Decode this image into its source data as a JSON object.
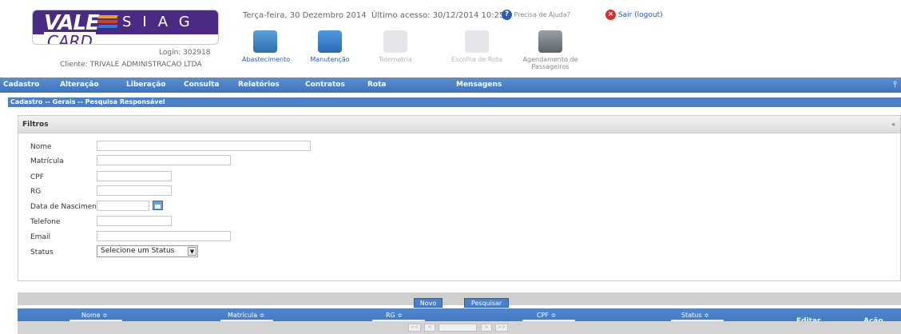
{
  "header": {
    "logo_vale": "VALE",
    "logo_card": "CARD",
    "logo_siag": "SIAG",
    "login": "Login: 302918",
    "cliente": "Cliente: TRIVALE ADMINISTRACAO LTDA",
    "date": "Terça-feira, 30 Dezembro 2014",
    "last_access": "Último acesso: 30/12/2014 10:25",
    "help": "Precisa de Ajuda?",
    "logout": "Sair (logout)"
  },
  "toolbar": [
    {
      "label": "Abastecimento",
      "icon": "fuel-icon"
    },
    {
      "label": "Manutenção",
      "icon": "wrench-icon"
    },
    {
      "label": "Telemetria",
      "icon": "signal-icon"
    },
    {
      "label": "Escolha de Rota",
      "icon": "map-icon"
    },
    {
      "label": "Agendamento de Passageiros",
      "icon": "bus-icon"
    }
  ],
  "nav": [
    "Cadastro",
    "Alteração",
    "Liberação",
    "Consulta",
    "Relatórios",
    "Contratos",
    "Rota",
    "Mensagens"
  ],
  "breadcrumb": "Cadastro -- Gerais -- Pesquisa Responsável",
  "filters": {
    "title": "Filtros",
    "collapse": "«",
    "nome": "Nome",
    "matricula": "Matrícula",
    "cpf": "CPF",
    "rg": "RG",
    "data_nascimento": "Data de Nascimento",
    "telefone": "Telefone",
    "email": "Email",
    "status": "Status",
    "status_selected": "Selecione um Status"
  },
  "buttons": {
    "novo": "Novo",
    "pesquisar": "Pesquisar"
  },
  "table": {
    "columns": [
      "Nome ≑",
      "Matrícula ≑",
      "RG ≑",
      "CPF ≑",
      "Status ≑"
    ],
    "editar": "Editar",
    "acao": "Ação"
  },
  "pager": [
    "<<",
    "<",
    ">",
    ">>"
  ],
  "colors": {
    "nav_blue": "#3e74bd",
    "logo_purple": "#4a2a85"
  }
}
